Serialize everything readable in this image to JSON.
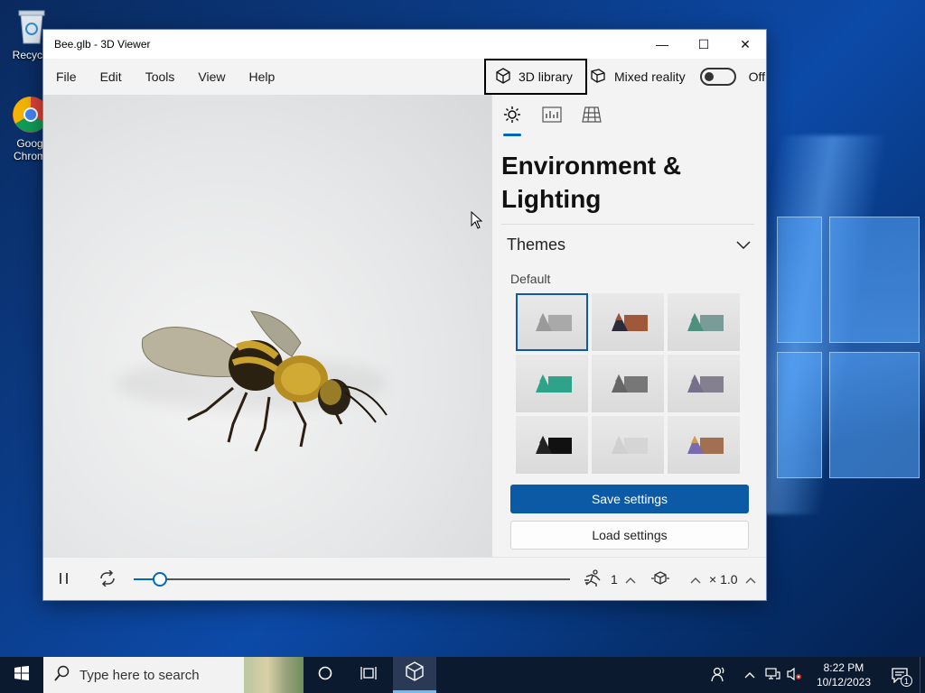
{
  "desktop": {
    "icons": [
      {
        "label": "Recycle"
      },
      {
        "label": "Goog\nChrom"
      }
    ]
  },
  "window": {
    "title": "Bee.glb - 3D Viewer",
    "controls": {
      "minimize": "—",
      "maximize": "☐",
      "close": "✕"
    }
  },
  "menu": {
    "items": [
      "File",
      "Edit",
      "Tools",
      "View",
      "Help"
    ],
    "library_label": "3D library",
    "mixed_reality_label": "Mixed reality",
    "toggle_state": "Off"
  },
  "panel": {
    "tabs": [
      "environment-lighting",
      "stats-shading",
      "grid-views"
    ],
    "title": "Environment & Lighting",
    "section_title": "Themes",
    "theme_label": "Default",
    "themes": [
      {
        "shape": "#9a9a9a",
        "cube": "#a9a9a9",
        "selected": true
      },
      {
        "shape": "#2b2b3a",
        "cube": "#a0583a",
        "tip": "#a0583a",
        "selected": false
      },
      {
        "shape": "#4f8f7d",
        "cube": "#7a9c98",
        "selected": false
      },
      {
        "shape": "#2fa38a",
        "cube": "#2fa38a",
        "selected": false
      },
      {
        "shape": "#666666",
        "cube": "#777777",
        "selected": false
      },
      {
        "shape": "#77708a",
        "cube": "#85808f",
        "selected": false
      },
      {
        "shape": "#222222",
        "cube": "#111111",
        "selected": false
      },
      {
        "shape": "#d0d0d0",
        "cube": "#d5d5d5",
        "selected": false
      },
      {
        "shape": "#7a6ab0",
        "cube": "#a07050",
        "tip": "#d8a040",
        "selected": false
      }
    ],
    "save_label": "Save settings",
    "load_label": "Load settings",
    "accent_color": "#0c5aa6"
  },
  "playback": {
    "progress": 0.06,
    "animation_index": "1",
    "speed": "× 1.0"
  },
  "taskbar": {
    "search_placeholder": "Type here to search",
    "time": "8:22 PM",
    "date": "10/12/2023",
    "notification_count": "1"
  }
}
